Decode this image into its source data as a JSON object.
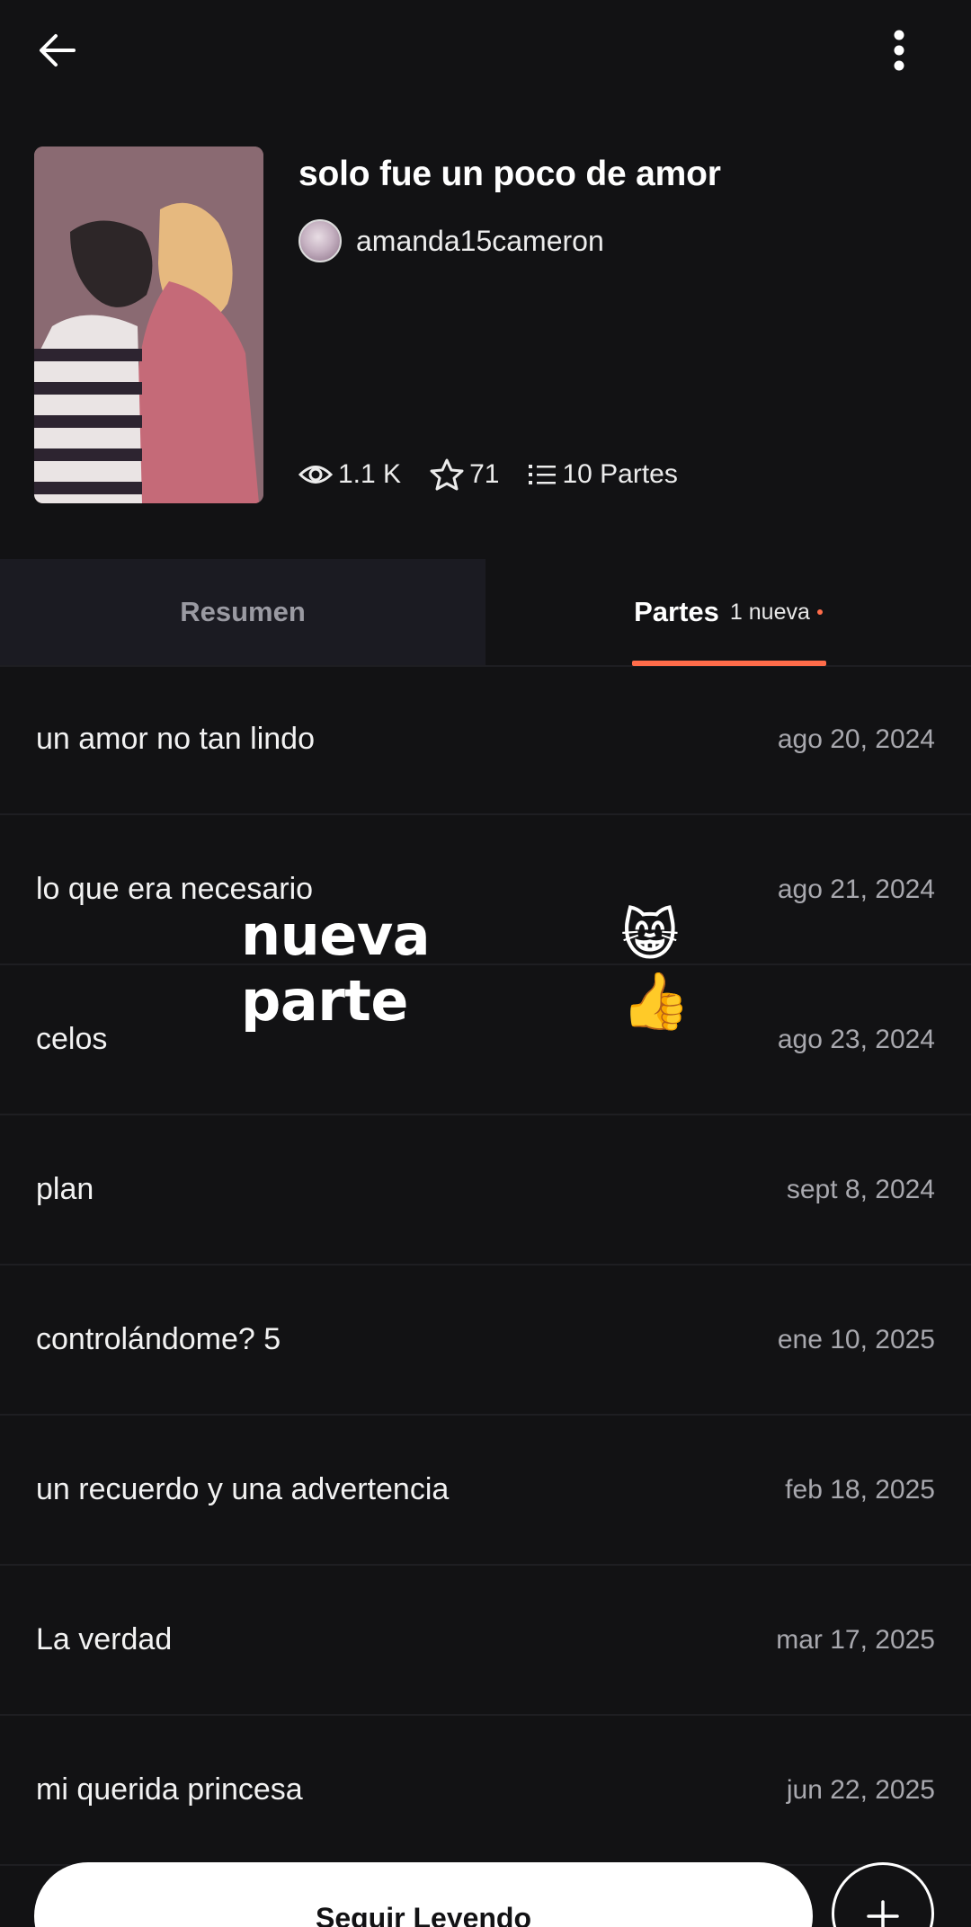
{
  "header": {
    "title": "solo fue un poco de amor",
    "author": "amanda15cameron",
    "stats": {
      "reads": "1.1 K",
      "votes": "71",
      "parts": "10 Partes"
    }
  },
  "tabs": {
    "summary": "Resumen",
    "parts": "Partes",
    "parts_badge": "1 nueva"
  },
  "parts": [
    {
      "title": "un amor no tan lindo",
      "date": "ago 20, 2024"
    },
    {
      "title": "lo que era necesario",
      "date": "ago 21, 2024"
    },
    {
      "title": "celos",
      "date": "ago 23, 2024"
    },
    {
      "title": "plan",
      "date": "sept 8, 2024"
    },
    {
      "title": "controlándome? 5",
      "date": "ene 10, 2025"
    },
    {
      "title": "un recuerdo y una advertencia",
      "date": "feb 18, 2025"
    },
    {
      "title": "La verdad",
      "date": "mar 17, 2025"
    },
    {
      "title": "mi querida princesa",
      "date": "jun 22, 2025"
    }
  ],
  "overlay": {
    "text": "nueva parte",
    "emoji": "😸👍"
  },
  "actions": {
    "continue": "Seguir Leyendo"
  },
  "icons": {
    "back": "arrow-left-icon",
    "more": "more-vertical-icon",
    "reads": "eye-icon",
    "votes": "star-icon",
    "parts": "list-icon",
    "add": "plus-icon"
  },
  "colors": {
    "background": "#121214",
    "accent": "#ff6c4a",
    "tab_inactive_bg": "#1b1b22"
  }
}
